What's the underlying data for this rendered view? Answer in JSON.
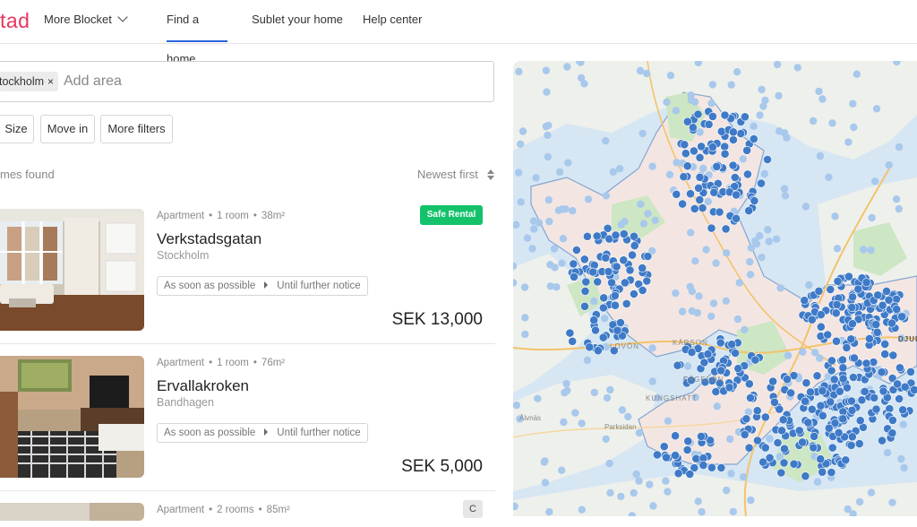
{
  "header": {
    "logo": "tad",
    "more_menu": "More Blocket",
    "nav": [
      "Find a home",
      "Sublet your home",
      "Help center"
    ]
  },
  "search": {
    "chip": "tockholm",
    "chip_close": "×",
    "placeholder": "Add area"
  },
  "filters": [
    "Size",
    "Move in",
    "More filters"
  ],
  "results": {
    "found_text": "mes found",
    "sort_label": "Newest first"
  },
  "listings": [
    {
      "type": "Apartment",
      "rooms": "1 room",
      "size": "38m²",
      "title": "Verkstadsgatan",
      "city": "Stockholm",
      "from": "As soon as possible",
      "to": "Until further notice",
      "price": "SEK 13,000",
      "badge": "Safe Rental"
    },
    {
      "type": "Apartment",
      "rooms": "1 room",
      "size": "76m²",
      "title": "Ervallakroken",
      "city": "Bandhagen",
      "from": "As soon as possible",
      "to": "Until further notice",
      "price": "SEK 5,000"
    },
    {
      "type": "Apartment",
      "rooms": "2 rooms",
      "size": "85m²",
      "badge": "C"
    }
  ],
  "map": {
    "labels": {
      "loven": "LOVÖN",
      "karson": "KÄRSON",
      "fagelon": "FÅGELÖN",
      "kungshatt": "KUNGSHATT",
      "alvnas": "Älvnäs",
      "parksidan": "Parksidan",
      "djur": "DJUR"
    },
    "marker_color": "#3e7ac7",
    "cluster_color": "#a8c8ec"
  },
  "colors": {
    "brand": "#e8365d",
    "accent": "#2b63d9",
    "safe": "#13c26b"
  }
}
